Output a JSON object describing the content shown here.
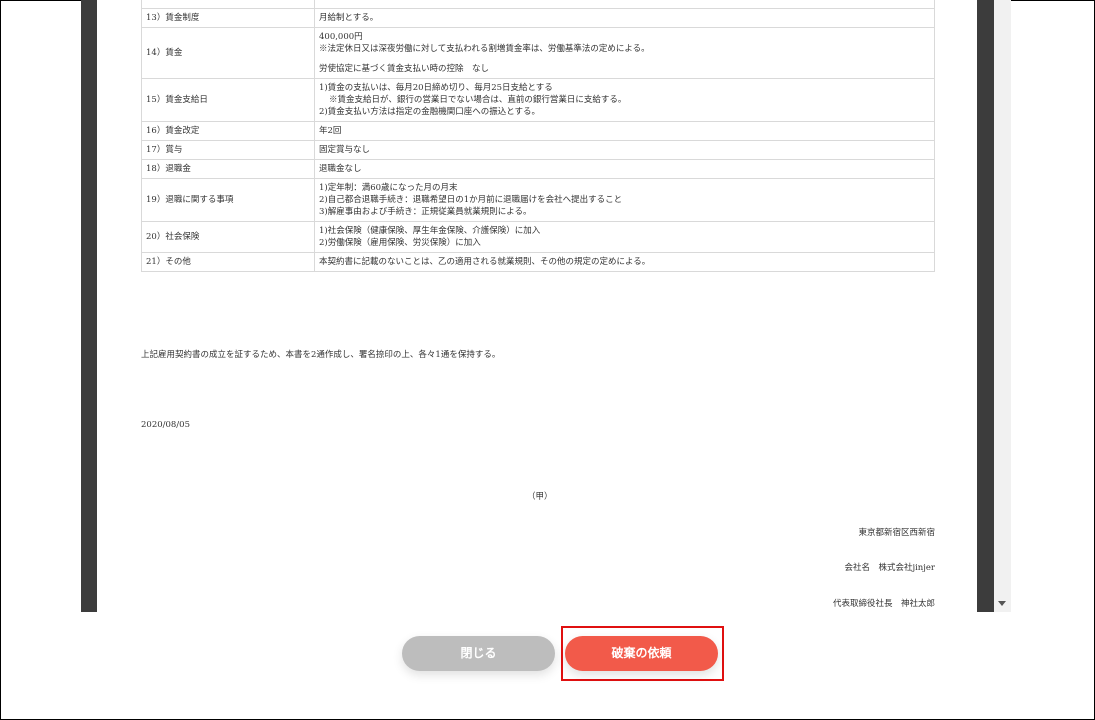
{
  "rows": [
    {
      "label": "13）賃金制度",
      "lines": [
        "月給制とする。"
      ]
    },
    {
      "label": "14）賃金",
      "lines": [
        "400,000円",
        "※法定休日又は深夜労働に対して支払われる割増賃金率は、労働基準法の定めによる。",
        "",
        "労使協定に基づく賃金支払い時の控除　なし"
      ]
    },
    {
      "label": "15）賃金支給日",
      "lines": [
        "1)賃金の支払いは、毎月20日締め切り、毎月25日支給とする",
        "※賃金支給日が、銀行の営業日でない場合は、直前の銀行営業日に支給する。",
        "2)賃金支払い方法は指定の金融機関口座への振込とする。"
      ]
    },
    {
      "label": "16）賃金改定",
      "lines": [
        "年2回"
      ]
    },
    {
      "label": "17）賞与",
      "lines": [
        "固定賞与なし"
      ]
    },
    {
      "label": "18）退職金",
      "lines": [
        "退職金なし"
      ]
    },
    {
      "label": "19）退職に関する事項",
      "lines": [
        "1)定年制：満60歳になった月の月末",
        "2)自己都合退職手続き：退職希望日の1か月前に退職届けを会社へ提出すること",
        "3)解雇事由および手続き：正規従業員就業規則による。"
      ]
    },
    {
      "label": "20）社会保険",
      "lines": [
        "1)社会保険（健康保険、厚生年金保険、介護保険）に加入",
        "2)労働保険（雇用保険、労災保険）に加入"
      ]
    },
    {
      "label": "21）その他",
      "lines": [
        "本契約書に記載のないことは、乙の適用される就業規則、その他の規定の定めによる。"
      ]
    }
  ],
  "closing_text": "上記雇用契約書の成立を証するため、本書を2通作成し、署名捺印の上、各々1通を保持する。",
  "date": "2020/08/05",
  "party_label": "（甲）",
  "address": "東京都新宿区西新宿",
  "company": "会社名　株式会社jinjer",
  "representative": "代表取締役社長　神社太郎",
  "buttons": {
    "close": "閉じる",
    "discard_request": "破棄の依頼"
  },
  "colors": {
    "close_button": "#bdbdbd",
    "discard_button": "#f25a4a",
    "highlight": "#e01010"
  }
}
